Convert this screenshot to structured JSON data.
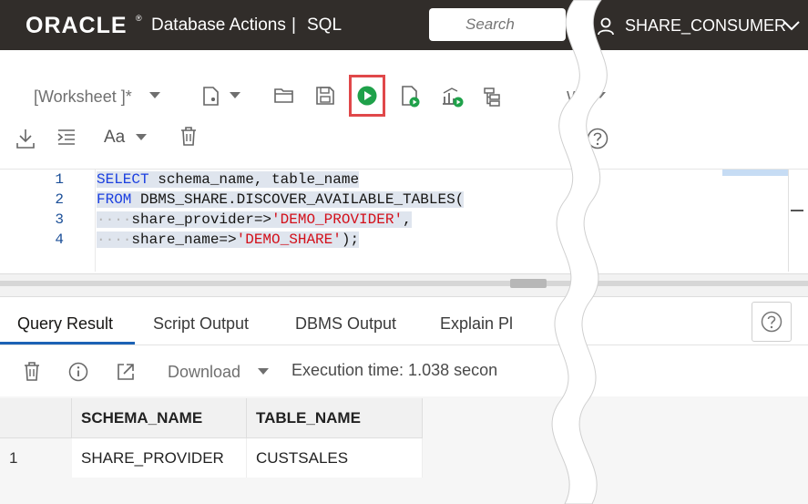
{
  "header": {
    "logo": "ORACLE",
    "logo_mark": "®",
    "app_title": "Database Actions",
    "separator": "|",
    "module": "SQL",
    "search_placeholder": "Search",
    "user": "SHARE_CONSUMER"
  },
  "toolbar": {
    "worksheet_tab": "[Worksheet ]*",
    "view_label": "W",
    "font_label": "Aa"
  },
  "editor": {
    "lines": [
      {
        "num": "1",
        "text": "SELECT schema_name, table_name"
      },
      {
        "num": "2",
        "text": "FROM DBMS_SHARE.DISCOVER_AVAILABLE_TABLES("
      },
      {
        "num": "3",
        "text": "share_provider=>'DEMO_PROVIDER',"
      },
      {
        "num": "4",
        "text": "share_name=>'DEMO_SHARE');"
      }
    ]
  },
  "result_tabs": [
    "Query Result",
    "Script Output",
    "DBMS Output",
    "Explain Pl"
  ],
  "result_toolbar": {
    "download": "Download",
    "execution_time": "Execution time: 1.038 secon"
  },
  "grid": {
    "columns": [
      "SCHEMA_NAME",
      "TABLE_NAME"
    ],
    "rows": [
      {
        "row_num": "1",
        "cells": [
          "SHARE_PROVIDER",
          "CUSTSALES"
        ]
      }
    ]
  },
  "colors": {
    "header_bg": "#312d2a",
    "run_button": "#1fa14a",
    "highlight_box": "#e0484a",
    "tab_active": "#1c62b5",
    "keyword": "#1b3fe0",
    "string": "#d3101a"
  }
}
